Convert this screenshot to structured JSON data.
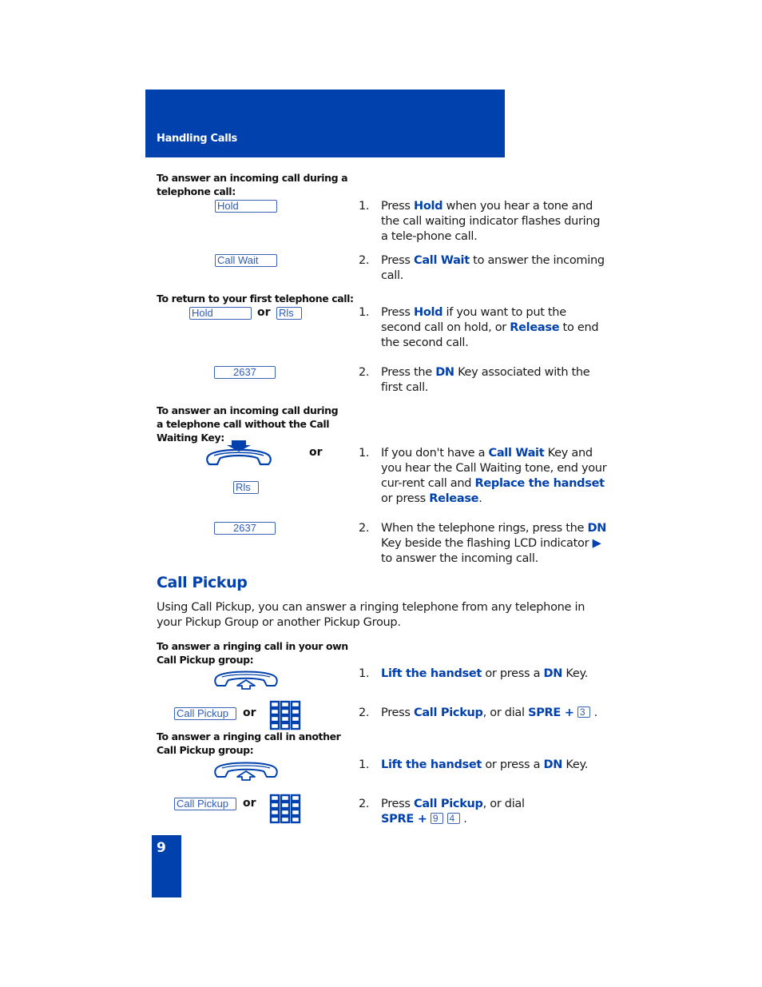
{
  "header": {
    "title": "Handling Calls"
  },
  "sections": [
    {
      "subhead": "To answer an incoming call during a telephone call:",
      "keys": [
        "Hold",
        "Call Wait"
      ],
      "steps": [
        {
          "num": "1.",
          "pre": "Press ",
          "hl1": "Hold",
          "post": " when you hear a tone and the call waiting indicator flashes during a tele-phone call."
        },
        {
          "num": "2.",
          "pre": "Press ",
          "hl1": "Call Wait",
          "post": " to answer the incoming call."
        }
      ]
    },
    {
      "subhead": "To return to your first telephone call:",
      "keys": [
        "Hold",
        "Rls",
        "2637"
      ],
      "or_label": "or",
      "steps": [
        {
          "num": "1.",
          "pre": "Press ",
          "hl1": "Hold",
          "mid": " if you want to put the second call on hold, or ",
          "hl2": "Release",
          "post": " to end the second call."
        },
        {
          "num": "2.",
          "pre": "Press the ",
          "hl1": "DN",
          "post": " Key associated with the first call."
        }
      ]
    },
    {
      "subhead": "To answer an incoming call during a telephone call without the Call Waiting Key:",
      "icon": "replace-handset-icon",
      "keys": [
        "Rls",
        "2637"
      ],
      "or_label": "or",
      "steps": [
        {
          "num": "1.",
          "pre": "If you don't have a ",
          "hl1": "Call Wait",
          "mid": " Key and you hear the Call Waiting tone, end your cur-rent call and ",
          "hl2": "Replace the handset",
          "mid2": " or press ",
          "hl3": "Release",
          "post": "."
        },
        {
          "num": "2.",
          "pre": "When the telephone rings, press the ",
          "hl1": "DN",
          "mid": " Key beside the flashing LCD indicator ",
          "indicator": "▶",
          "post": " to answer the incoming call."
        }
      ]
    }
  ],
  "call_pickup": {
    "title": "Call Pickup",
    "intro": "Using Call Pickup, you can answer a ringing telephone from any telephone in your Pickup Group or another Pickup Group.",
    "groups": [
      {
        "subhead": "To answer a ringing call in your own Call Pickup group:",
        "key": "Call Pickup",
        "or_label": "or",
        "steps": [
          {
            "num": "1.",
            "hl1": "Lift the handset",
            "mid": " or press a ",
            "hl2": "DN",
            "post": " Key."
          },
          {
            "num": "2.",
            "pre": "Press ",
            "hl1": "Call Pickup",
            "mid": ", or dial ",
            "hl2": "SPRE +",
            "digits": [
              "3"
            ],
            "post": "."
          }
        ]
      },
      {
        "subhead": "To answer a ringing call in another Call Pickup group:",
        "key": "Call Pickup",
        "or_label": "or",
        "steps": [
          {
            "num": "1.",
            "hl1": "Lift the handset",
            "mid": " or press a ",
            "hl2": "DN",
            "post": " Key."
          },
          {
            "num": "2.",
            "pre": "Press ",
            "hl1": "Call Pickup",
            "mid": ", or dial",
            "hl2": "SPRE +",
            "digits": [
              "9",
              "4"
            ],
            "post": "."
          }
        ]
      }
    ]
  },
  "page_number": "9",
  "colors": {
    "brand_blue": "#0041ad",
    "key_border": "#3b63b8"
  }
}
